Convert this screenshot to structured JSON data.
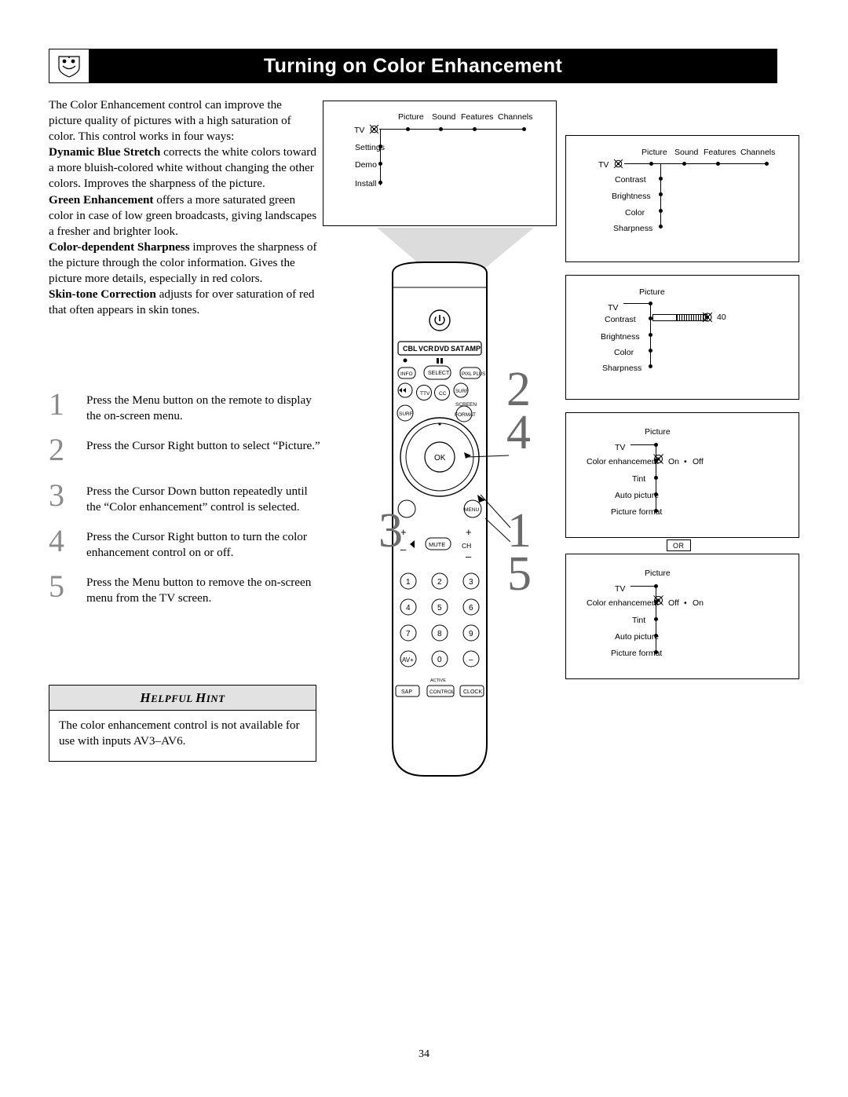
{
  "header": {
    "title": "Turning on Color Enhancement",
    "logo_icon": "philips-shield-icon"
  },
  "intro": {
    "paragraph1": "The Color Enhancement control can improve the picture quality of pictures with a high saturation of color. This control works in four ways:",
    "features": [
      {
        "term": "Dynamic Blue Stretch",
        "text": " corrects the white colors toward a more bluish-colored white without changing the other colors. Improves the sharpness of the picture."
      },
      {
        "term": "Green Enhancement",
        "text": " offers a more saturated green color in case of low green broadcasts, giving landscapes a fresher and brighter look."
      },
      {
        "term": "Color-dependent Sharpness",
        "text": " improves the sharpness of the picture through the color information. Gives the picture more details, especially in red colors."
      },
      {
        "term": "Skin-tone Correction",
        "text": " adjusts for over saturation of red that often appears in skin tones."
      }
    ]
  },
  "steps": [
    {
      "number": "1",
      "text": "Press the Menu button on the remote to display the on-screen menu."
    },
    {
      "number": "2",
      "text": "Press the Cursor Right button to select “Picture.”"
    },
    {
      "number": "3",
      "text": "Press the Cursor Down button repeatedly until the “Color enhancement” control is selected."
    },
    {
      "number": "4",
      "text": "Press the Cursor Right button to turn the color enhancement control on or off."
    },
    {
      "number": "5",
      "text": "Press the Menu button to remove the on-screen menu from the TV screen."
    }
  ],
  "hint": {
    "title_first": "H",
    "title_rest1": "ELPFUL ",
    "title_first2": "H",
    "title_rest2": "INT",
    "body": "The color enhancement control is not available for use with inputs AV3–AV6."
  },
  "osd": {
    "panel1": {
      "menu_bar": [
        "Picture",
        "Sound",
        "Features",
        "Channels"
      ],
      "tv_label": "TV",
      "rows": [
        "Settings",
        "Demo",
        "Install"
      ]
    },
    "panel2": {
      "menu_bar": [
        "Picture",
        "Sound",
        "Features",
        "Channels"
      ],
      "tv_label": "TV",
      "rows": [
        "Contrast",
        "Brightness",
        "Color",
        "Sharpness"
      ]
    },
    "panel3": {
      "heading": "Picture",
      "tv_label": "TV",
      "rows": [
        "Contrast",
        "Brightness",
        "Color",
        "Sharpness"
      ],
      "slider_value": "40"
    },
    "panel4": {
      "heading": "Picture",
      "tv_label": "TV",
      "rows": [
        "Color enhancement",
        "Tint",
        "Auto picture",
        "Picture format"
      ],
      "toggle_left": "On",
      "toggle_sep": "•",
      "toggle_right": "Off"
    },
    "or_badge": "OR",
    "panel5": {
      "heading": "Picture",
      "tv_label": "TV",
      "rows": [
        "Color enhancement",
        "Tint",
        "Auto picture",
        "Picture format"
      ],
      "toggle_left": "Off",
      "toggle_sep": "•",
      "toggle_right": "On"
    }
  },
  "remote": {
    "source_buttons": [
      "CBL",
      "VCR",
      "DVD",
      "SAT",
      "AMP"
    ],
    "row_info": [
      "INFO",
      "SELECT",
      "PIXL PLUS"
    ],
    "row_tfc": [
      "TTV",
      "CC",
      "SURF"
    ],
    "row_surr": [
      "SURF",
      "FORMAT"
    ],
    "screen_label": "SCREEN",
    "ok_label": "OK",
    "menu_label": "MENU",
    "mute_label": "MUTE",
    "ch_label": "CH",
    "vol_plus": "+",
    "vol_minus": "–",
    "ch_plus": "+",
    "ch_minus": "–",
    "keypad": [
      "1",
      "2",
      "3",
      "4",
      "5",
      "6",
      "7",
      "8",
      "9",
      "AV+",
      "0",
      "–"
    ],
    "bottom_buttons": [
      "SAP",
      "CONTROL",
      "CLOCK"
    ],
    "bottom_small_label": "ACTIVE"
  },
  "callouts": {
    "num2": "2",
    "num4": "4",
    "num3": "3",
    "num1": "1",
    "num5": "5"
  },
  "page_number": "34"
}
